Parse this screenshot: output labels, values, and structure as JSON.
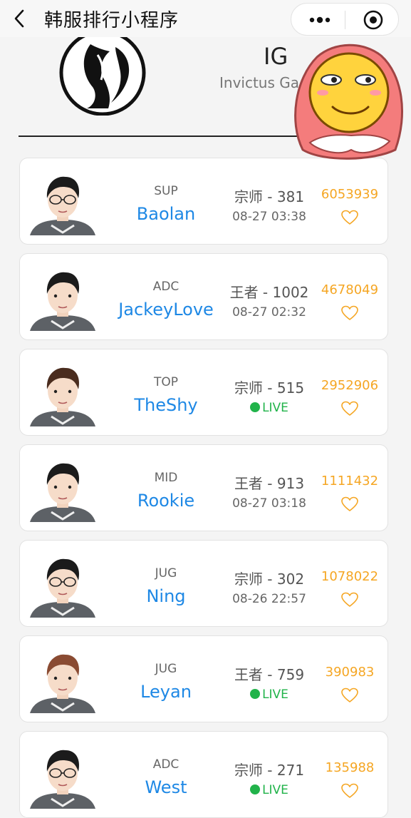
{
  "header": {
    "title": "韩服排行小程序",
    "back_icon": "chevron-left-icon",
    "more_icon": "more-dots-icon",
    "close_icon": "target-circle-icon"
  },
  "team": {
    "abbr": "IG",
    "name": "Invictus Ga"
  },
  "players": [
    {
      "position": "SUP",
      "name": "Baolan",
      "rank": "宗师 - 381",
      "status": "08-27 03:38",
      "live": false,
      "likes": "6053939",
      "hair": "#1b1b1b",
      "glasses": true
    },
    {
      "position": "ADC",
      "name": "JackeyLove",
      "rank": "王者 - 1002",
      "status": "08-27 02:32",
      "live": false,
      "likes": "4678049",
      "hair": "#1b1b1b",
      "glasses": false
    },
    {
      "position": "TOP",
      "name": "TheShy",
      "rank": "宗师 - 515",
      "status": "LIVE",
      "live": true,
      "likes": "2952906",
      "hair": "#4a2c1e",
      "glasses": false
    },
    {
      "position": "MID",
      "name": "Rookie",
      "rank": "王者 - 913",
      "status": "08-27 03:18",
      "live": false,
      "likes": "1111432",
      "hair": "#1b1b1b",
      "glasses": false
    },
    {
      "position": "JUG",
      "name": "Ning",
      "rank": "宗师 - 302",
      "status": "08-26 22:57",
      "live": false,
      "likes": "1078022",
      "hair": "#1b1b1b",
      "glasses": true
    },
    {
      "position": "JUG",
      "name": "Leyan",
      "rank": "王者 - 759",
      "status": "LIVE",
      "live": true,
      "likes": "390983",
      "hair": "#8a4b32",
      "glasses": false
    },
    {
      "position": "ADC",
      "name": "West",
      "rank": "宗师 - 271",
      "status": "LIVE",
      "live": true,
      "likes": "135988",
      "hair": "#1b1b1b",
      "glasses": true
    }
  ],
  "colors": {
    "player_name": "#1e88e5",
    "likes": "#f5a623",
    "live": "#21b34a"
  }
}
